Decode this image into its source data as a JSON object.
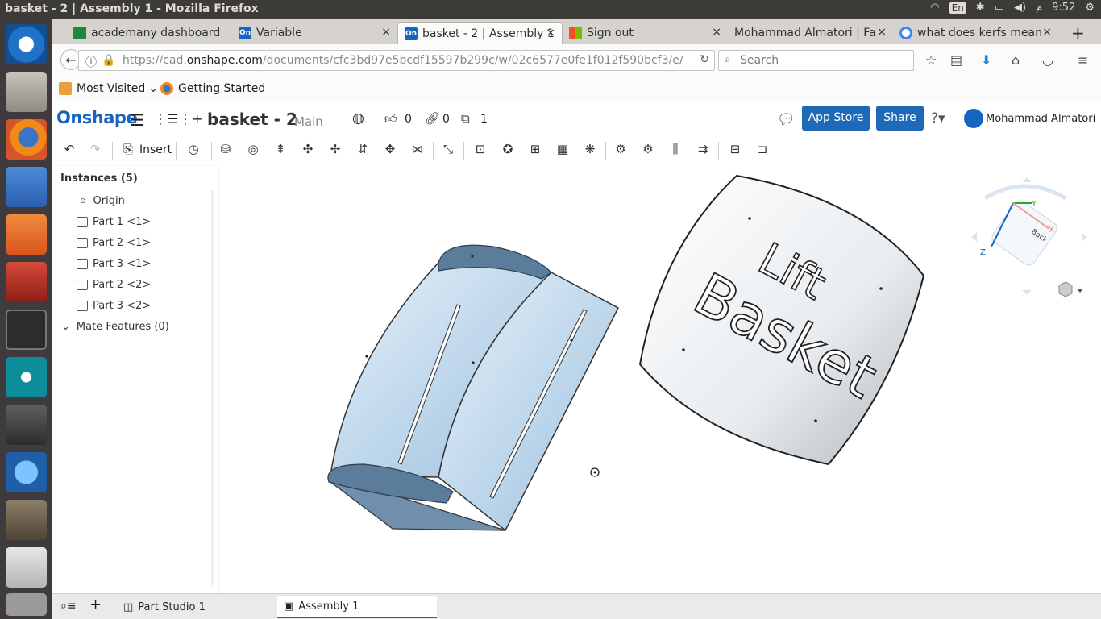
{
  "window": {
    "title": "basket - 2 | Assembly 1 - Mozilla Firefox",
    "clock": "9:52",
    "ampm": "م",
    "lang": "En"
  },
  "tabs": [
    {
      "label": "academany dashboard",
      "icon": "grid-favicon",
      "close": "×"
    },
    {
      "label": "Variable",
      "icon": "onshape-favicon",
      "close": "×"
    },
    {
      "label": "basket - 2 | Assembly 1",
      "icon": "onshape-favicon",
      "close": "×"
    },
    {
      "label": "Sign out",
      "icon": "microsoft-favicon",
      "close": "×"
    },
    {
      "label": "Mohammad Almatori | Fa",
      "icon": "none",
      "close": "×"
    },
    {
      "label": "what does kerfs mean",
      "icon": "google-favicon",
      "close": "×"
    }
  ],
  "new_tab": "+",
  "nav": {
    "url_prefix": "https://cad.",
    "url_domain": "onshape.com",
    "url_path": "/documents/cfc3bd97e5bcdf15597b299c/w/02c6577e0fe1f012f590bcf3/e/",
    "search_placeholder": "Search"
  },
  "bookmarks": {
    "most_visited": "Most Visited",
    "getting_started": "Getting Started"
  },
  "onshape": {
    "brand": "Onshape",
    "doc_title": "basket - 2",
    "branch": "Main",
    "likes": "0",
    "links": "0",
    "copies": "1",
    "app_store": "App Store",
    "share": "Share",
    "user": "Mohammad Almatori"
  },
  "toolbar": {
    "insert": "Insert"
  },
  "panel": {
    "instances_header": "Instances (5)",
    "origin": "Origin",
    "items": [
      "Part 1 <1>",
      "Part 2 <1>",
      "Part 3 <1>",
      "Part 2 <2>",
      "Part 3 <2>"
    ],
    "mate_features": "Mate Features (0)"
  },
  "viewport": {
    "panel_text_line1": "Lift",
    "panel_text_line2": "Basket",
    "cube_axis_y": "Y",
    "cube_axis_x": "X",
    "cube_axis_z": "Z",
    "cube_face": "Back"
  },
  "bottom": {
    "tab1": "Part Studio 1",
    "tab2": "Assembly 1"
  },
  "colors": {
    "accent": "#1565c0",
    "part_blue": "#b9d4e9",
    "part_dark": "#5b7c9b",
    "ubuntu_bar": "#3c3b37"
  }
}
